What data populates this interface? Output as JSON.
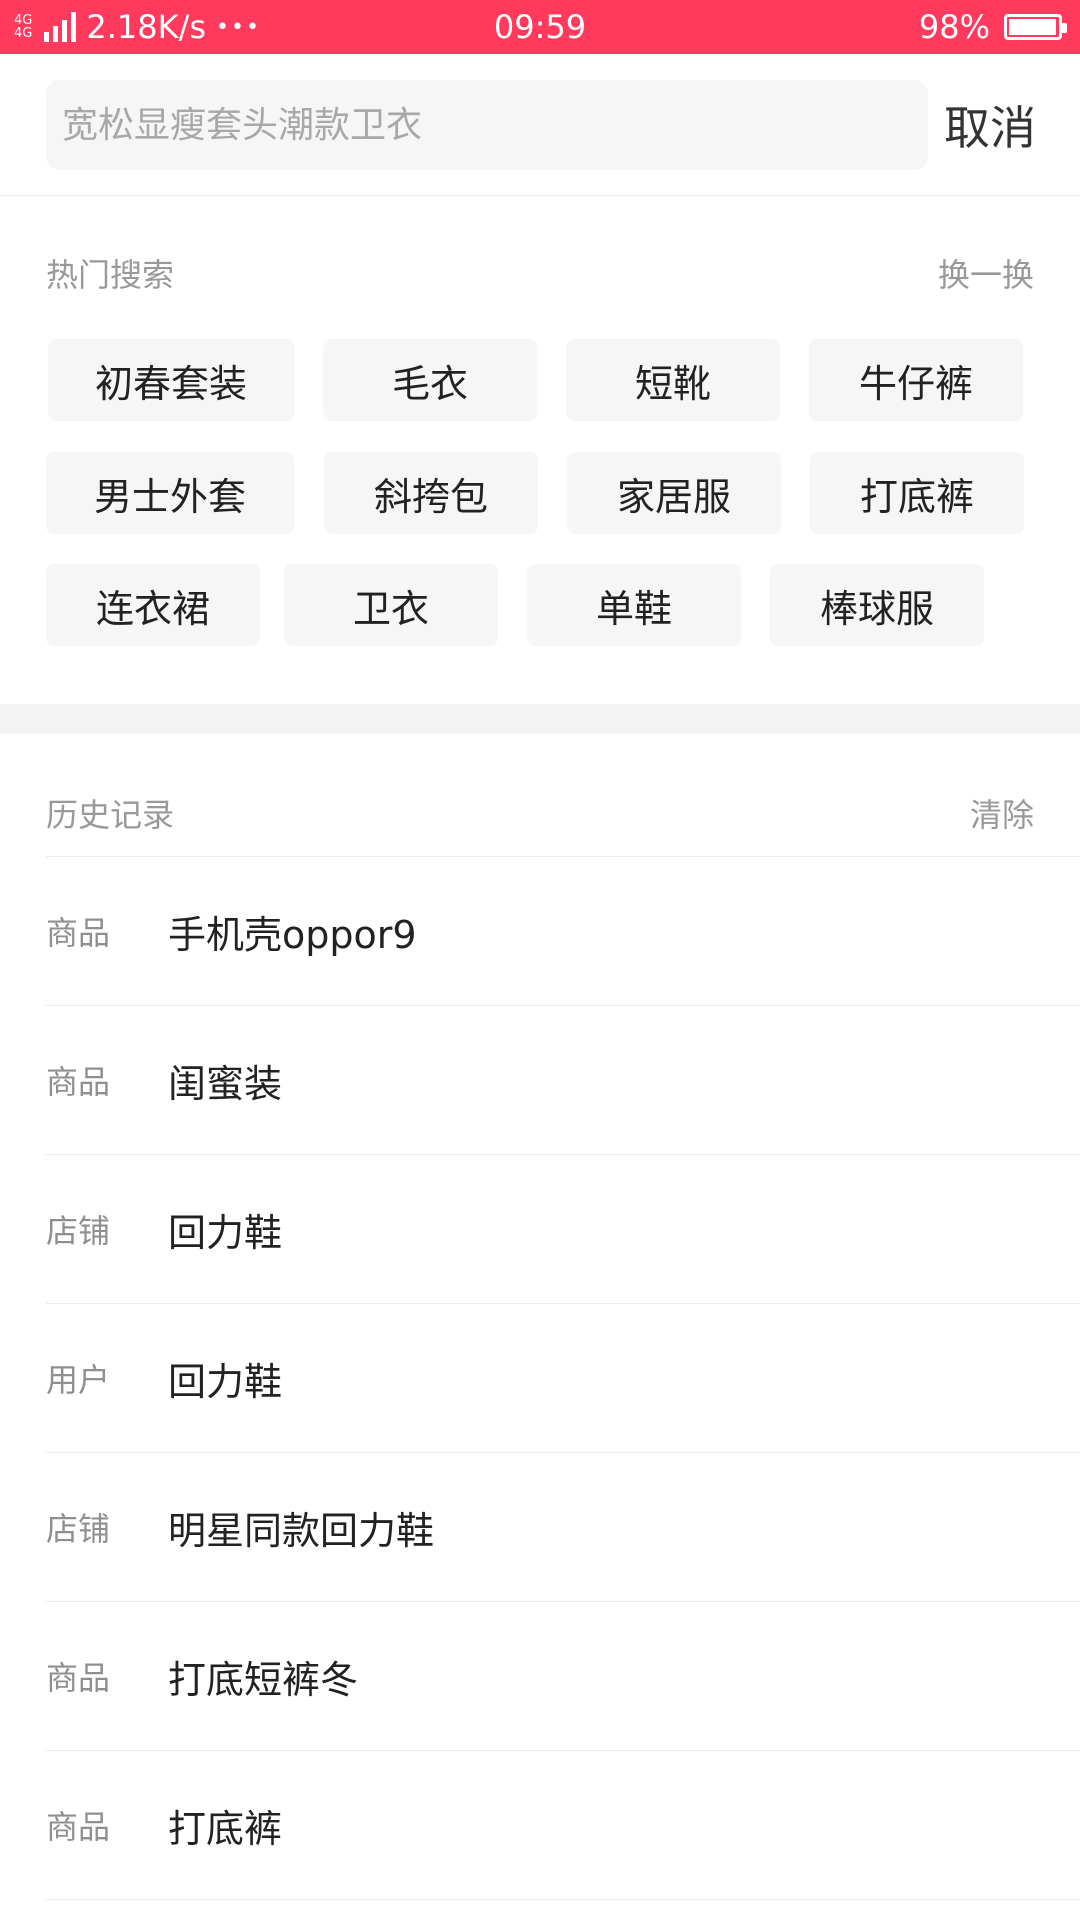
{
  "status_bar": {
    "network_top": "4G",
    "network_second": "4G",
    "speed": "2.18K/s",
    "dots": "•••",
    "time": "09:59",
    "battery": "98%",
    "battery_level": 0.98,
    "color": "#ff3a5c"
  },
  "search": {
    "placeholder": "宽松显瘦套头潮款卫衣",
    "value": "",
    "cancel_label": "取消"
  },
  "hot": {
    "title": "热门搜索",
    "refresh_label": "换一换",
    "tags": [
      "初春套装",
      "毛衣",
      "短靴",
      "牛仔裤",
      "男士外套",
      "斜挎包",
      "家居服",
      "打底裤",
      "连衣裙",
      "卫衣",
      "单鞋",
      "棒球服"
    ]
  },
  "history": {
    "title": "历史记录",
    "clear_label": "清除",
    "items": [
      {
        "type": "商品",
        "text": "手机壳oppor9"
      },
      {
        "type": "商品",
        "text": "闺蜜装"
      },
      {
        "type": "店铺",
        "text": "回力鞋"
      },
      {
        "type": "用户",
        "text": "回力鞋"
      },
      {
        "type": "店铺",
        "text": "明星同款回力鞋"
      },
      {
        "type": "商品",
        "text": "打底短裤冬"
      },
      {
        "type": "商品",
        "text": "打底裤"
      }
    ]
  }
}
